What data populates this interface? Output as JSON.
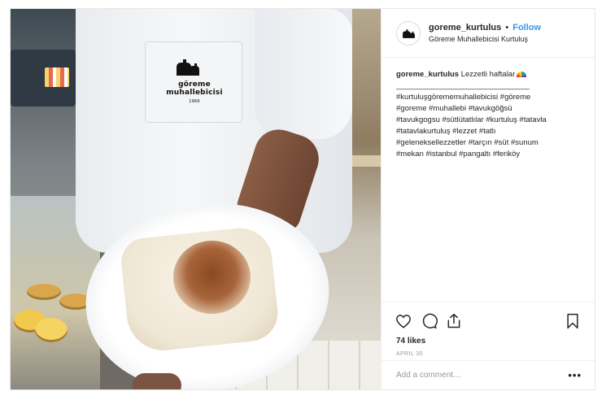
{
  "post": {
    "username": "goreme_kurtulus",
    "separator": "•",
    "follow_label": "Follow",
    "location": "Göreme Muhallebicisi Kurtuluş",
    "photo": {
      "alt": "A plate of tavukgöğsü with cinnamon held by a man in a Göreme Muhallebicisi coat",
      "pocket_text": "göreme muhallebicisi",
      "pocket_subtext": "1966"
    },
    "caption": {
      "username": "goreme_kurtulus",
      "text": "Lezzetli haftalar",
      "emoji": "rainbow",
      "divider": "_______________________________",
      "hashtag_lines": [
        "#kurtuluşgörememuhallebicisi #göreme",
        "#goreme #muhallebi #tavukgöğsü",
        "#tavukgogsu #sütlütatlılar #kurtuluş #tatavla",
        "#tatavlakurtuluş #lezzet #tatlı",
        "#geleneksellezzetler #tarçın #süt #sunum",
        "#mekan #istanbul #pangaltı #feriköy"
      ]
    },
    "actions": {
      "like": "heart-icon",
      "comment": "comment-icon",
      "share": "share-icon",
      "save": "bookmark-icon"
    },
    "likes": "74 likes",
    "date": "APRIL 30",
    "comment": {
      "placeholder": "Add a comment…",
      "value": "",
      "more_label": "•••"
    }
  }
}
